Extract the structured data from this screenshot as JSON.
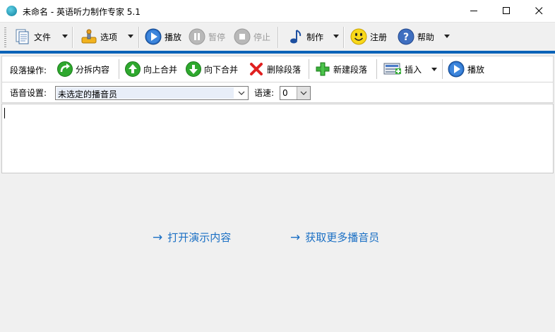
{
  "window": {
    "title": "未命名 - 英语听力制作专家 5.1"
  },
  "toolbar": {
    "file": "文件",
    "options": "选项",
    "play": "播放",
    "pause": "暂停",
    "stop": "停止",
    "make": "制作",
    "register": "注册",
    "help": "帮助"
  },
  "paragraph_toolbar": {
    "label": "段落操作:",
    "split": "分拆内容",
    "merge_up": "向上合并",
    "merge_down": "向下合并",
    "delete": "删除段落",
    "new": "新建段落",
    "insert": "插入",
    "play": "播放"
  },
  "voice": {
    "label": "语音设置:",
    "voice_value": "未选定的播音员",
    "speed_label": "语速:",
    "speed_value": "0"
  },
  "links": {
    "open_demo": "打开演示内容",
    "more_voices": "获取更多播音员"
  },
  "colors": {
    "accent": "#0b63b8",
    "link": "#1a6fc4"
  }
}
